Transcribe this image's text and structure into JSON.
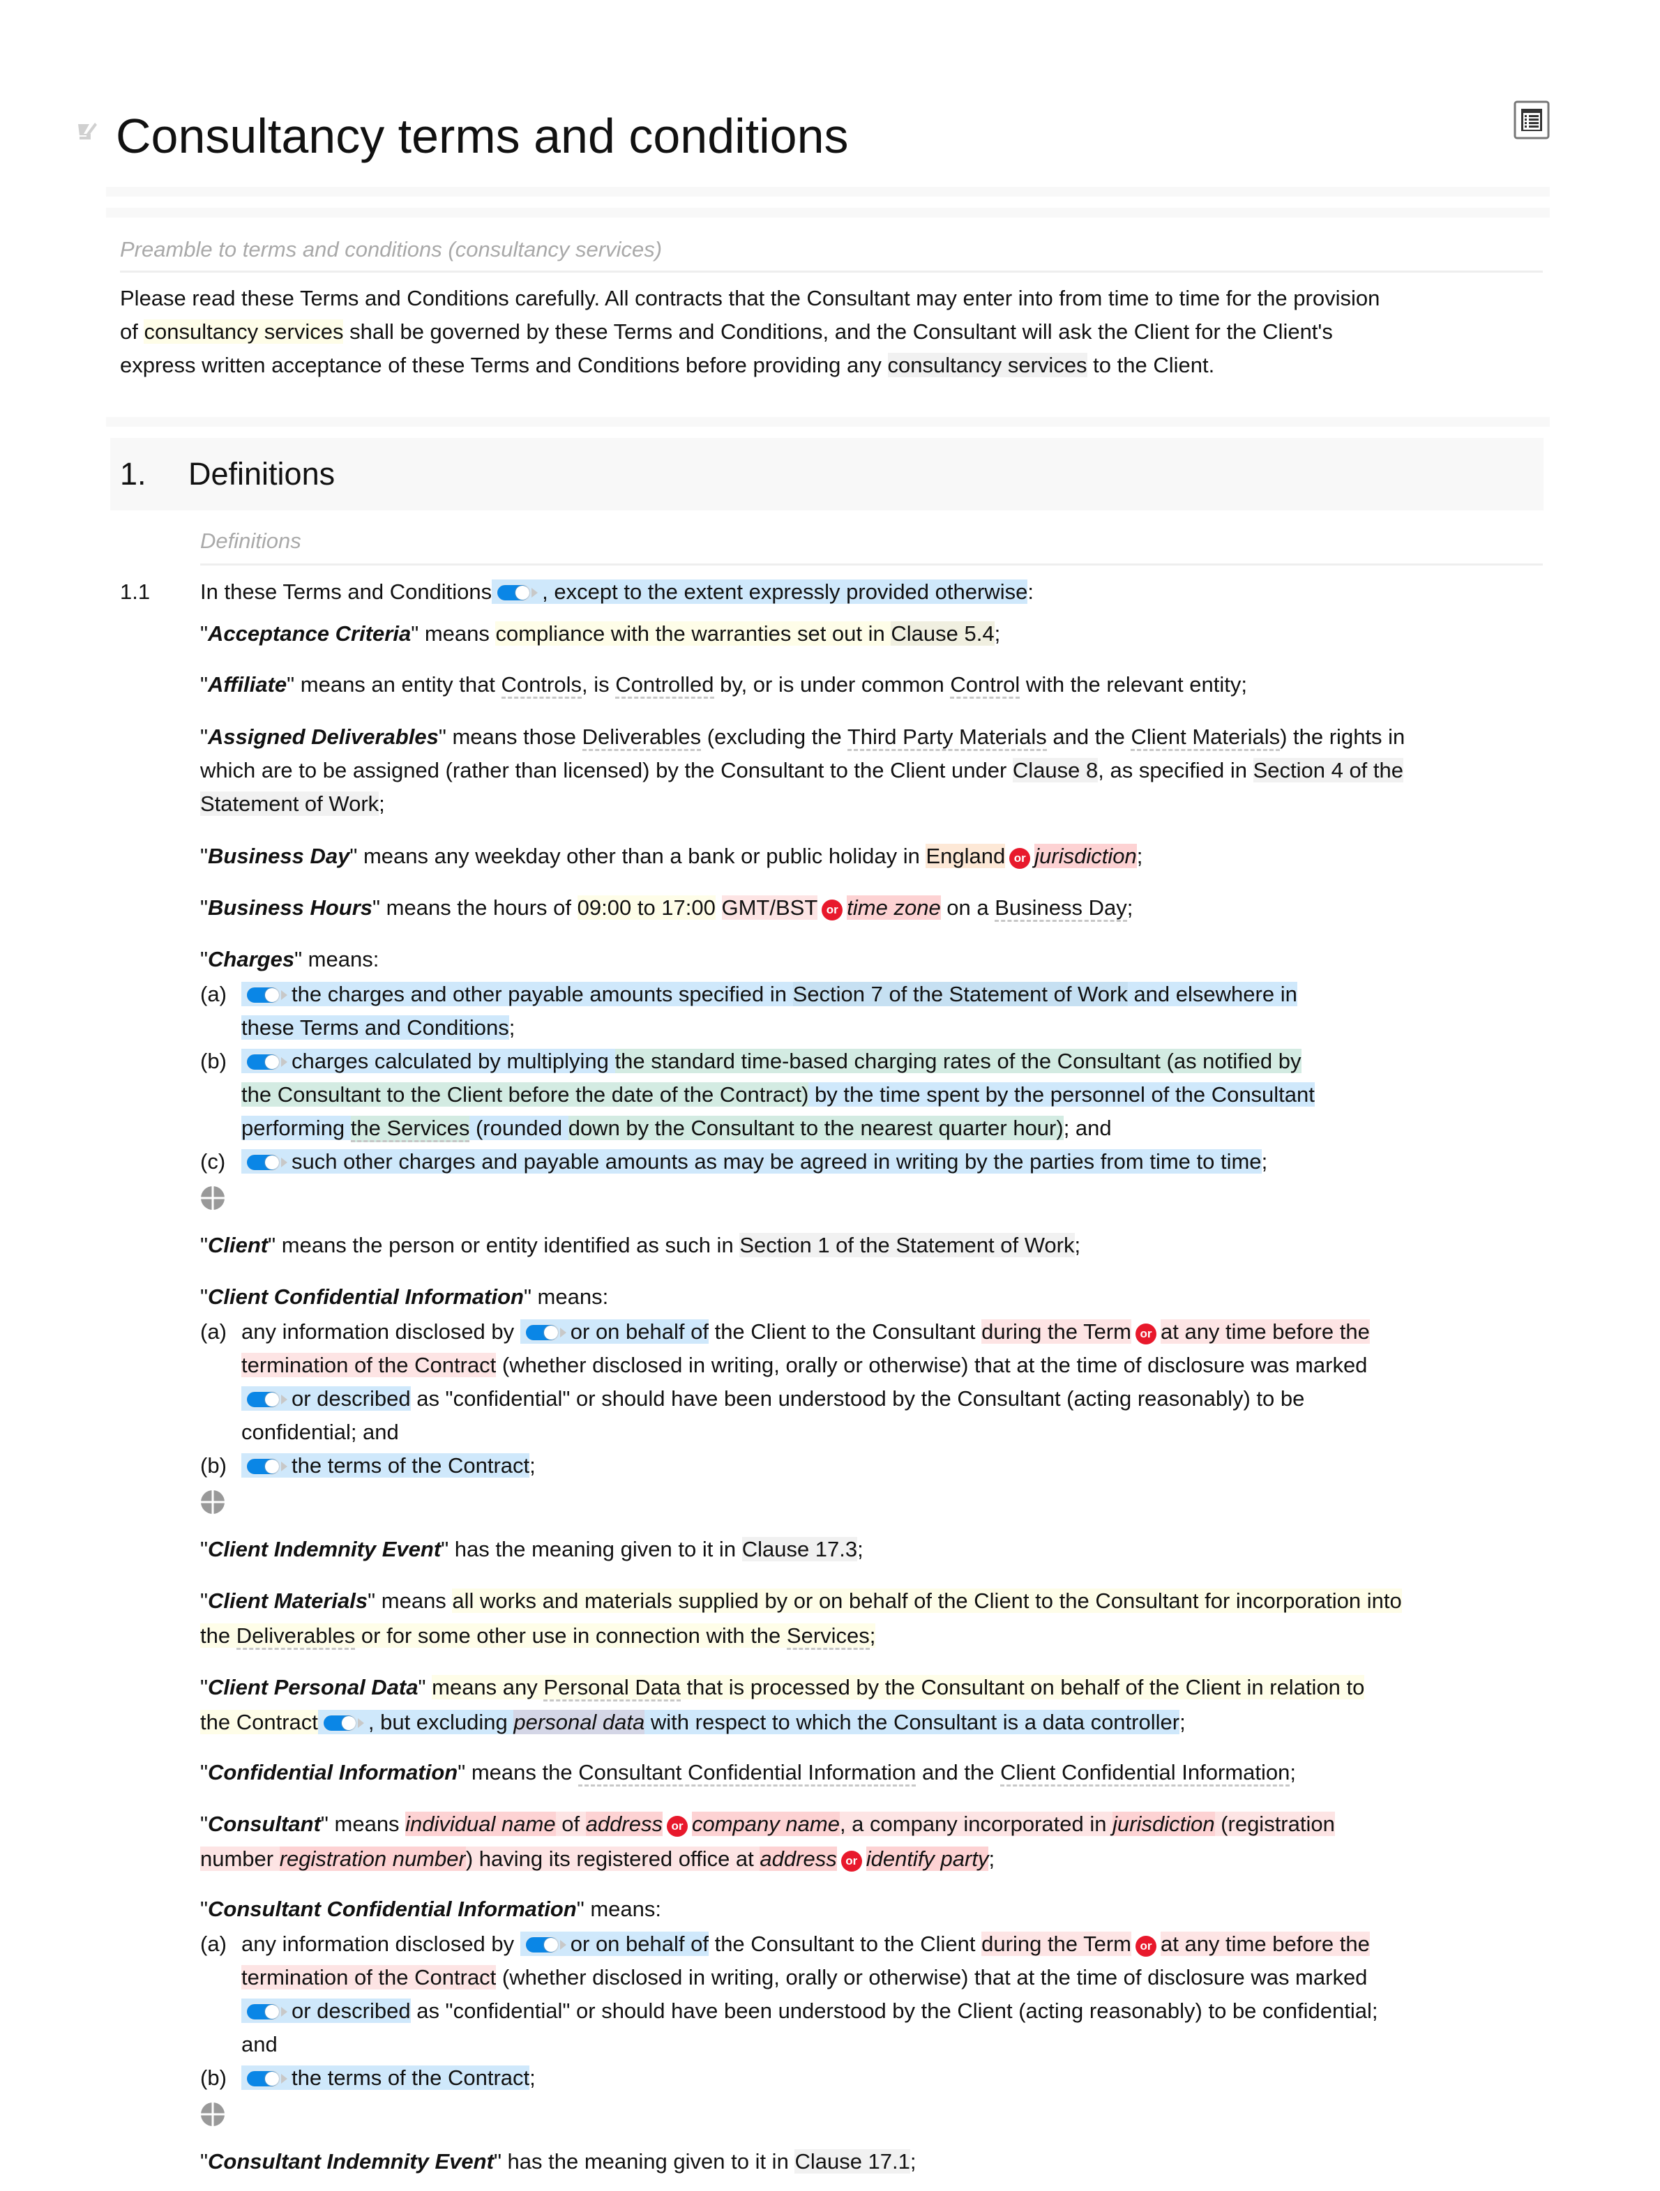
{
  "document": {
    "title": "Consultancy terms and conditions",
    "edit_icon": "edit-pencil-icon",
    "toc_icon": "table-of-contents-icon"
  },
  "preamble": {
    "heading": "Preamble to terms and conditions (consultancy services)",
    "p1": "Please read these Terms and Conditions carefully. All contracts that the Consultant may enter into from time to time for the provision",
    "p2a": "of ",
    "p2b": "consultancy services",
    "p2c": " shall be governed by these Terms and Conditions, and the Consultant will ask the Client for the Client's",
    "p3a": "express written acceptance of these Terms and Conditions before providing any ",
    "p3b": "consultancy services",
    "p3c": " to the Client."
  },
  "section": {
    "number": "1.",
    "title": "Definitions",
    "subheading": "Definitions",
    "clause_num": "1.1",
    "intro_a": "In these Terms and Conditions",
    "intro_b": ", except to the extent expressly provided otherwise",
    "intro_c": ":"
  },
  "or_label": "or",
  "defs": {
    "acceptance": {
      "q1": "\"",
      "term": "Acceptance Criteria",
      "q2": "\" means ",
      "t1": "compliance with the warranties set out in ",
      "ref": "Clause 5.4",
      "end": ";"
    },
    "affiliate": {
      "q1": "\"",
      "term": "Affiliate",
      "q2": "\" means an entity that ",
      "a": "Controls",
      "b": ", is ",
      "c": "Controlled",
      "d": " by, or is under common ",
      "e": "Control",
      "f": " with the relevant entity;"
    },
    "assigned": {
      "q1": "\"",
      "term": "Assigned Deliverables",
      "q2": "\" means those ",
      "a": "Deliverables",
      "b": " (excluding the ",
      "c": "Third Party Materials",
      "d": " and the ",
      "e": "Client Materials",
      "f": ") the rights in",
      "l2a": "which are to be assigned (rather than licensed) by the Consultant to the Client under ",
      "l2b": "Clause 8",
      "l2c": ", as specified in ",
      "l2d": "Section 4 of the",
      "l3a": "Statement of Work",
      "l3b": ";"
    },
    "business_day": {
      "q1": "\"",
      "term": "Business Day",
      "q2": "\" means any weekday other than a bank or public holiday in ",
      "opt1": "England",
      "opt2": "jurisdiction",
      "end": ";"
    },
    "business_hours": {
      "q1": "\"",
      "term": "Business Hours",
      "q2": "\" means the hours of ",
      "a": "09:00 to 17:00",
      "b": " ",
      "opt1": "GMT/BST",
      "opt2": "time zone",
      "c": " on a ",
      "d": "Business Day",
      "end": ";"
    },
    "charges": {
      "q1": "\"",
      "term": "Charges",
      "q2": "\" means:",
      "items": [
        {
          "label": "(a)",
          "l1a": "the charges and other payable amounts specified in ",
          "l1b": "Section 7 of the Statement of Work",
          "l1c": " and elsewhere in",
          "l2a": "these Terms and Conditions",
          "l2b": ";"
        },
        {
          "label": "(b)",
          "l1a": "charges calculated by multiplying ",
          "l1b": "the standard time-based charging rates of the Consultant (as notified by",
          "l2a": "the Consultant to the Client before the date of the Contract)",
          "l2b": " by the time spent by the personnel of the Consultant",
          "l3a": "performing ",
          "l3b": "the Services",
          "l3c": " (rounded ",
          "l3d": "down by the Consultant to the nearest quarter hour)",
          "l3e": "; and"
        },
        {
          "label": "(c)",
          "l1a": "such other charges and payable amounts as may be agreed in writing by the parties from time to time",
          "l1b": ";"
        }
      ]
    },
    "client": {
      "q1": "\"",
      "term": "Client",
      "q2": "\" means the person or entity identified as such in ",
      "ref": "Section 1 of the Statement of Work",
      "end": ";"
    },
    "client_ci": {
      "q1": "\"",
      "term": "Client Confidential Information",
      "q2": "\" means:",
      "a_label": "(a)",
      "a1": "any information disclosed by ",
      "a2": "or on behalf of",
      "a3": " the Client to the Consultant ",
      "a4": "during the Term",
      "a5": "at any time before the",
      "a6": "termination of the Contract",
      "a7": " (whether disclosed in writing, orally or otherwise) that at the time of disclosure was marked",
      "a8": "or described",
      "a9": " as \"confidential\" or should have been understood by the Consultant (acting reasonably) to be",
      "a10": "confidential; and",
      "b_label": "(b)",
      "b1": "the terms of the Contract",
      "b2": ";"
    },
    "client_ie": {
      "q1": "\"",
      "term": "Client Indemnity Event",
      "q2": "\" has the meaning given to it in ",
      "ref": "Clause 17.3",
      "end": ";"
    },
    "client_materials": {
      "q1": "\"",
      "term": "Client Materials",
      "q2": "\" means ",
      "l1": "all works and materials supplied by or on behalf of the Client to the Consultant for incorporation into",
      "l2a": "the ",
      "l2b": "Deliverables",
      "l2c": " or for some other use in connection with the ",
      "l2d": "Services",
      "l2e": ";"
    },
    "client_pd": {
      "q1": "\"",
      "term": "Client Personal Data",
      "q2": "\" ",
      "l1a": "means any ",
      "l1b": "Personal Data",
      "l1c": " that is processed by the Consultant on behalf of the Client in relation to",
      "l2a": "the Contract",
      "l2b": ", but excluding ",
      "l2c": "personal data",
      "l2d": " with respect to which the Consultant is a data controller",
      "l2e": ";"
    },
    "confidential": {
      "q1": "\"",
      "term": "Confidential Information",
      "q2": "\" means the ",
      "a": "Consultant Confidential Information",
      "b": " and the ",
      "c": "Client Confidential Information",
      "d": ";"
    },
    "consultant": {
      "q1": "\"",
      "term": "Consultant",
      "q2": "\" means ",
      "a": "individual name",
      "b": " of ",
      "c": "address",
      "d": "company name",
      "e": ", a company incorporated in ",
      "f": "jurisdiction",
      "g": " (registration",
      "h": "number ",
      "i": "registration number",
      "j": ") having its registered office at ",
      "k": "address",
      "l": "identify party",
      "m": ";"
    },
    "consultant_ci": {
      "q1": "\"",
      "term": "Consultant Confidential Information",
      "q2": "\" means:",
      "a_label": "(a)",
      "a1": "any information disclosed by ",
      "a2": "or on behalf of",
      "a3": " the Consultant to the Client ",
      "a4": "during the Term",
      "a5": "at any time before the",
      "a6": "termination of the Contract",
      "a7": " (whether disclosed in writing, orally or otherwise) that at the time of disclosure was marked",
      "a8": "or described",
      "a9": " as \"confidential\" or should have been understood by the Client (acting reasonably) to be confidential;",
      "a10": "and",
      "b_label": "(b)",
      "b1": "the terms of the Contract",
      "b2": ";"
    },
    "consultant_ie": {
      "q1": "\"",
      "term": "Consultant Indemnity Event",
      "q2": "\" has the meaning given to it in ",
      "ref": "Clause 17.1",
      "end": ";"
    }
  }
}
